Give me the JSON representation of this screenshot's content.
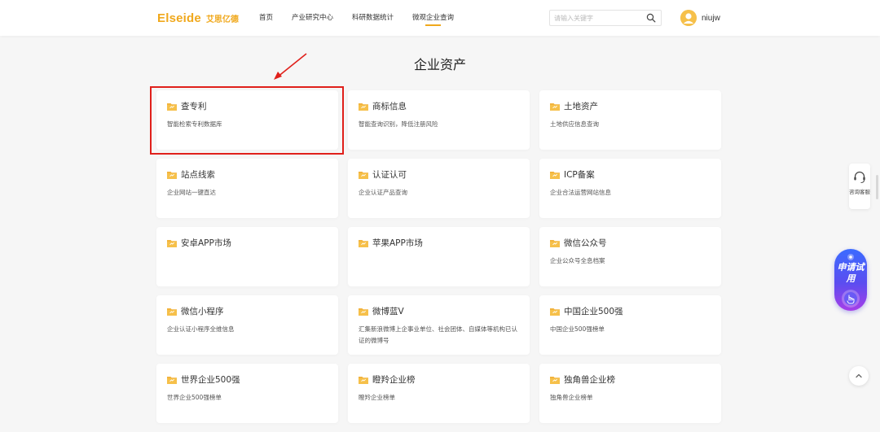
{
  "header": {
    "logo_en": "Elseide",
    "logo_cn": "艾思亿德",
    "nav": [
      "首页",
      "产业研究中心",
      "科研数据统计",
      "微观企业查询"
    ],
    "active_nav": "微观企业查询",
    "search": {
      "placeholder": "请输入关键字",
      "value": ""
    },
    "user": {
      "name": "niujw"
    }
  },
  "page_title": "企业资产",
  "cards": [
    {
      "title": "查专利",
      "desc": "智能检索专利数据库"
    },
    {
      "title": "商标信息",
      "desc": "智能查询识别，降低注册风险"
    },
    {
      "title": "土地资产",
      "desc": "土地供应信息查询"
    },
    {
      "title": "站点线索",
      "desc": "企业网站一键直达"
    },
    {
      "title": "认证认可",
      "desc": "企业认证产品查询"
    },
    {
      "title": "ICP备案",
      "desc": "企业合法运营网站信息"
    },
    {
      "title": "安卓APP市场",
      "desc": ""
    },
    {
      "title": "苹果APP市场",
      "desc": ""
    },
    {
      "title": "微信公众号",
      "desc": "企业公众号全息档案"
    },
    {
      "title": "微信小程序",
      "desc": "企业认证小程序全维信息"
    },
    {
      "title": "微博蓝V",
      "desc": "汇集新浪微博上企事业单位、社会团体、自媒体等机构已认证的微博号"
    },
    {
      "title": "中国企业500强",
      "desc": "中国企业500强榜单"
    },
    {
      "title": "世界企业500强",
      "desc": "世界企业500强榜单"
    },
    {
      "title": "瞪羚企业榜",
      "desc": "瞪羚企业榜单"
    },
    {
      "title": "独角兽企业榜",
      "desc": "独角兽企业榜单"
    }
  ],
  "floating": {
    "consult_label": "咨询客服",
    "trial_label": "申请试用"
  },
  "colors": {
    "brand": "#f0a81c",
    "highlight_annotation": "#e0201b",
    "trial_gradient": [
      "#3b6bff",
      "#a63ee8"
    ]
  },
  "icons": [
    "search-icon",
    "avatar",
    "folder-icon",
    "headset-icon",
    "hand-pointer-icon",
    "chevron-up-icon"
  ]
}
